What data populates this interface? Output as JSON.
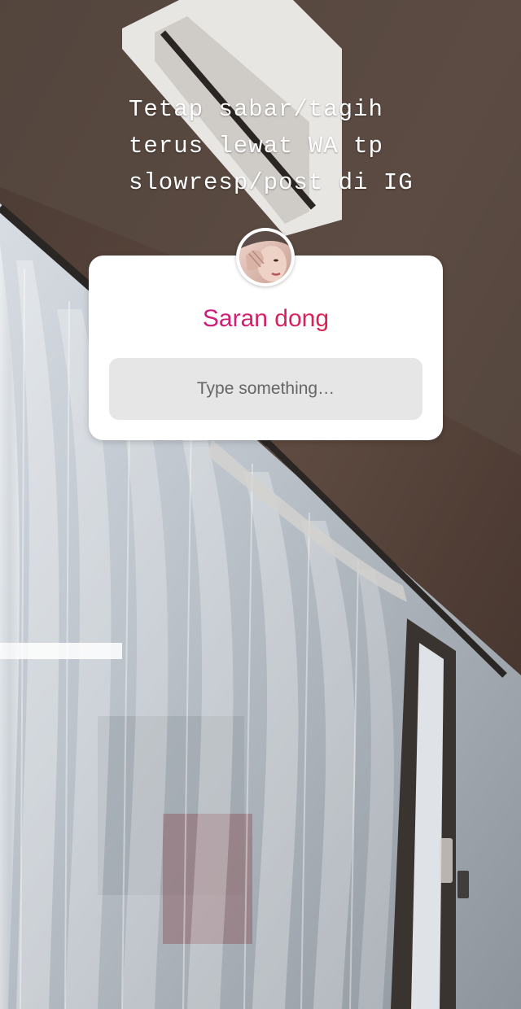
{
  "caption": {
    "lines": [
      "Tetap sabar/tagih",
      "terus lewat WA tp",
      "slowresp/post di IG"
    ]
  },
  "question_sticker": {
    "title": "Saran dong",
    "input_placeholder": "Type something…",
    "avatar_icon": "profile-photo-avatar"
  },
  "colors": {
    "title_gradient_start": "#b81aa8",
    "title_gradient_end": "#e3282c",
    "card_background": "#ffffff",
    "input_background": "#e6e6e6"
  }
}
